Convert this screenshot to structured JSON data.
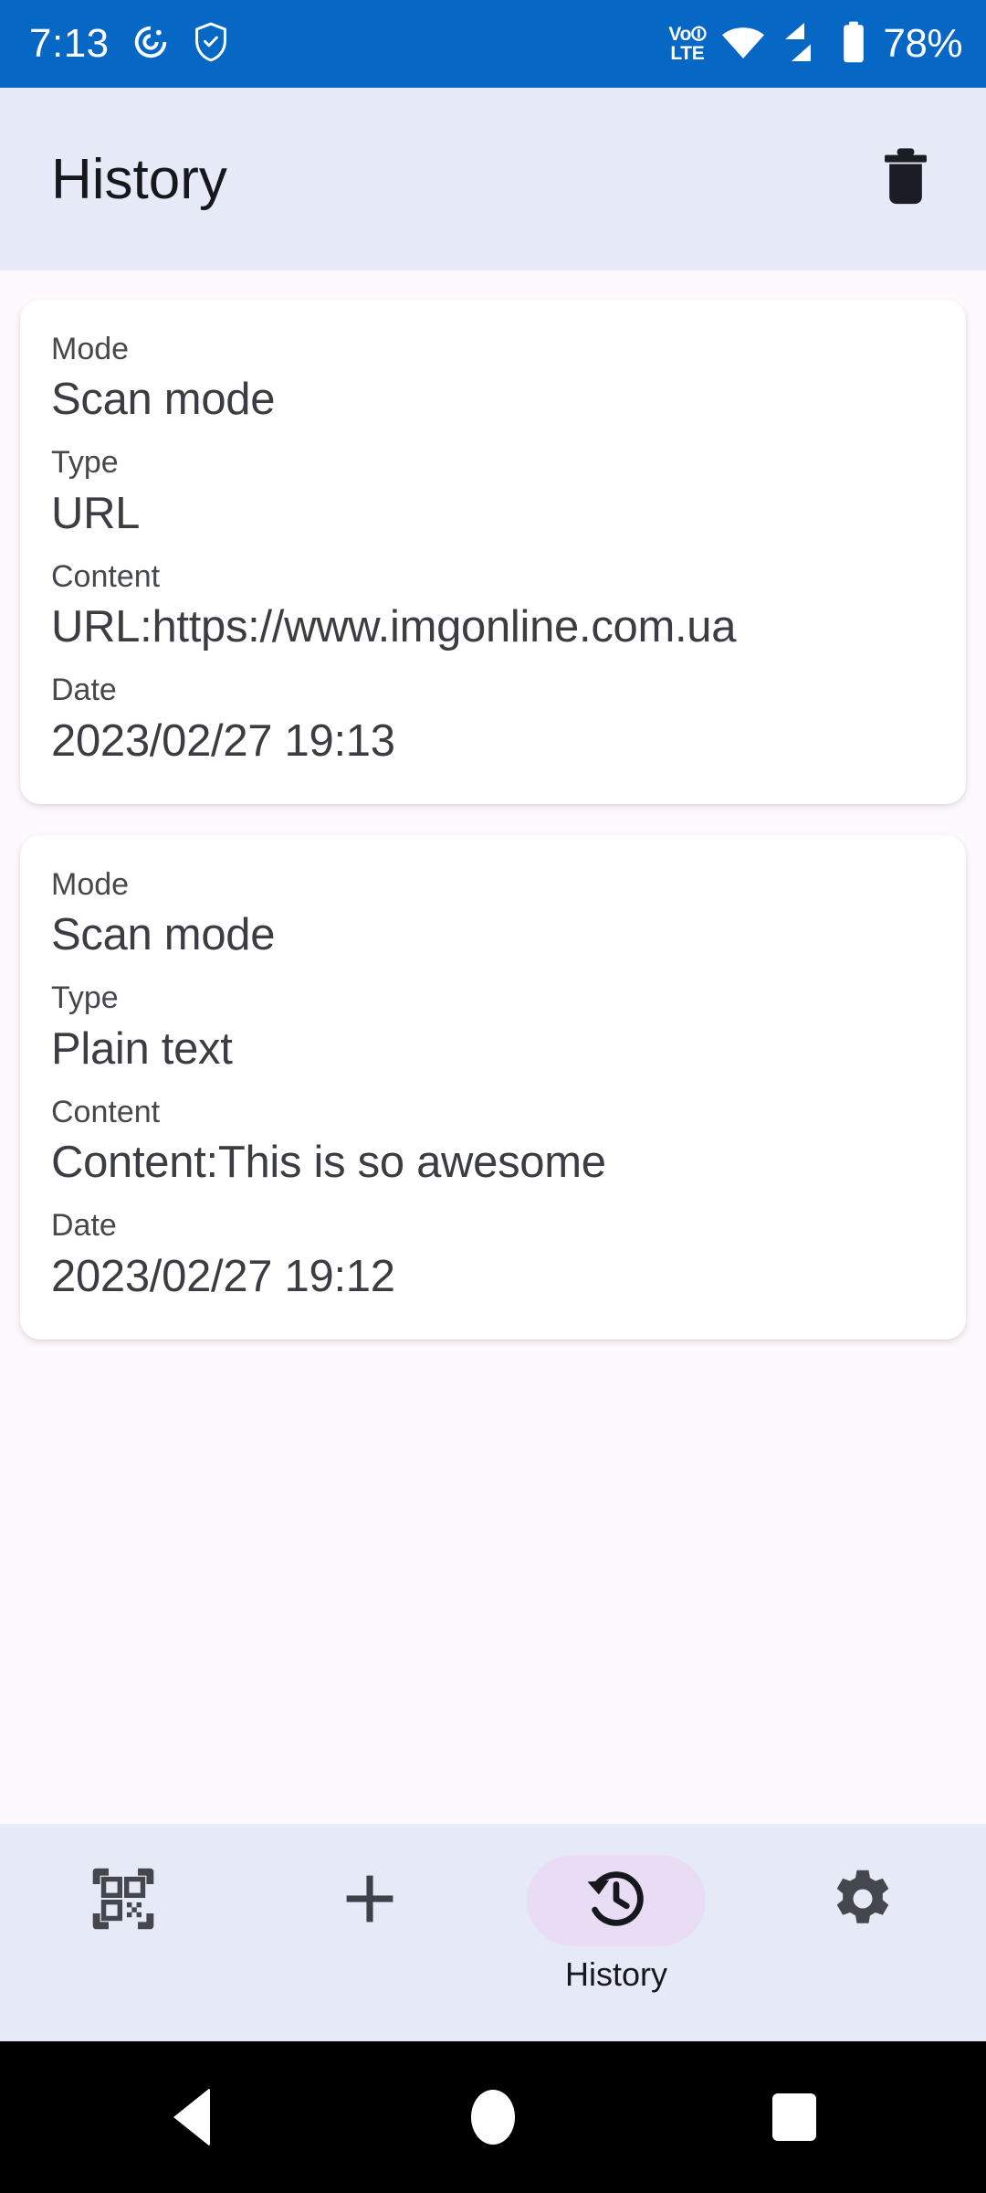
{
  "status_bar": {
    "time": "7:13",
    "network_label_top": "Vo",
    "network_label_bottom": "LTE",
    "battery_percent": "78%",
    "background_color": "#0668c4"
  },
  "header": {
    "title": "History",
    "delete_icon": "trash-icon",
    "background_color": "#e6eaf6"
  },
  "history": {
    "labels": {
      "mode": "Mode",
      "type": "Type",
      "content": "Content",
      "date": "Date"
    },
    "items": [
      {
        "mode": "Scan mode",
        "type": "URL",
        "content": "URL:https://www.imgonline.com.ua",
        "date": "2023/02/27 19:13"
      },
      {
        "mode": "Scan mode",
        "type": "Plain text",
        "content": "Content:This is so awesome",
        "date": "2023/02/27 19:12"
      }
    ]
  },
  "bottom_nav": {
    "background_color": "#e6eaf6",
    "active_pill_color": "#e9ddf5",
    "items": [
      {
        "icon": "qr-scan-icon",
        "label": "",
        "active": false
      },
      {
        "icon": "plus-icon",
        "label": "",
        "active": false
      },
      {
        "icon": "history-clock-icon",
        "label": "History",
        "active": true
      },
      {
        "icon": "gear-icon",
        "label": "",
        "active": false
      }
    ]
  },
  "android_nav": {
    "back": "back-triangle-icon",
    "home": "home-circle-icon",
    "recents": "recents-square-icon"
  }
}
